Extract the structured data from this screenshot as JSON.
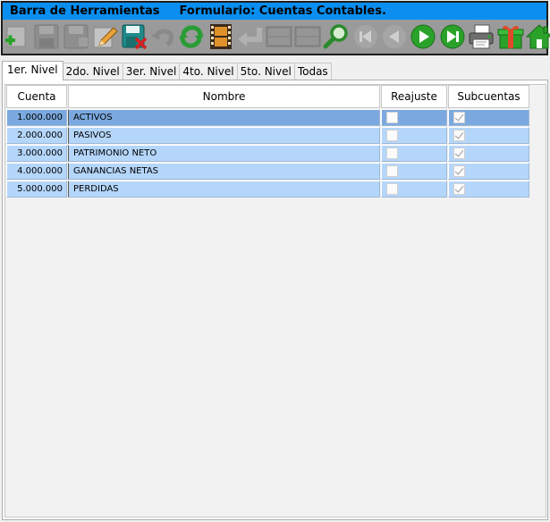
{
  "toolbar": {
    "title_left": "Barra de Herramientas",
    "title_right": "Formulario: Cuentas Contables.",
    "buttons": [
      {
        "icon": "add-icon",
        "enabled": true
      },
      {
        "icon": "save-icon",
        "enabled": false
      },
      {
        "icon": "save-as-icon",
        "enabled": false
      },
      {
        "icon": "edit-pencil-icon",
        "enabled": true
      },
      {
        "icon": "save-delete-icon",
        "enabled": true
      },
      {
        "icon": "undo-icon",
        "enabled": false
      },
      {
        "icon": "refresh-icon",
        "enabled": true
      },
      {
        "icon": "film-icon",
        "enabled": true
      },
      {
        "icon": "return-icon",
        "enabled": false
      },
      {
        "icon": "panel-icon",
        "enabled": false
      },
      {
        "icon": "panel-2-icon",
        "enabled": false
      },
      {
        "icon": "search-magnifier-icon",
        "enabled": true
      },
      {
        "icon": "first-record-icon",
        "enabled": false
      },
      {
        "icon": "previous-record-icon",
        "enabled": false
      },
      {
        "icon": "next-record-icon",
        "enabled": true
      },
      {
        "icon": "last-record-icon",
        "enabled": true
      },
      {
        "icon": "printer-icon",
        "enabled": true
      },
      {
        "icon": "gift-icon",
        "enabled": true
      },
      {
        "icon": "home-icon",
        "enabled": true
      }
    ]
  },
  "tabs": [
    {
      "label": "1er. Nivel",
      "active": true
    },
    {
      "label": "2do. Nivel",
      "active": false
    },
    {
      "label": "3er. Nivel",
      "active": false
    },
    {
      "label": "4to. Nivel",
      "active": false
    },
    {
      "label": "5to. Nivel",
      "active": false
    },
    {
      "label": "Todas",
      "active": false
    }
  ],
  "grid": {
    "columns": [
      "Cuenta",
      "Nombre",
      "Reajuste",
      "Subcuentas"
    ],
    "rows": [
      {
        "cuenta": "1.000.000",
        "nombre": "ACTIVOS",
        "reajuste": false,
        "subcuentas": true,
        "selected": true
      },
      {
        "cuenta": "2.000.000",
        "nombre": "PASIVOS",
        "reajuste": false,
        "subcuentas": true,
        "selected": false
      },
      {
        "cuenta": "3.000.000",
        "nombre": "PATRIMONIO NETO",
        "reajuste": false,
        "subcuentas": true,
        "selected": false
      },
      {
        "cuenta": "4.000.000",
        "nombre": "GANANCIAS NETAS",
        "reajuste": false,
        "subcuentas": true,
        "selected": false
      },
      {
        "cuenta": "5.000.000",
        "nombre": "PERDIDAS",
        "reajuste": false,
        "subcuentas": true,
        "selected": false
      }
    ]
  },
  "colors": {
    "title_bar": "#0a8ff0",
    "row_bg": "#b5d6fb",
    "row_selected_bg": "#7ba9df"
  }
}
